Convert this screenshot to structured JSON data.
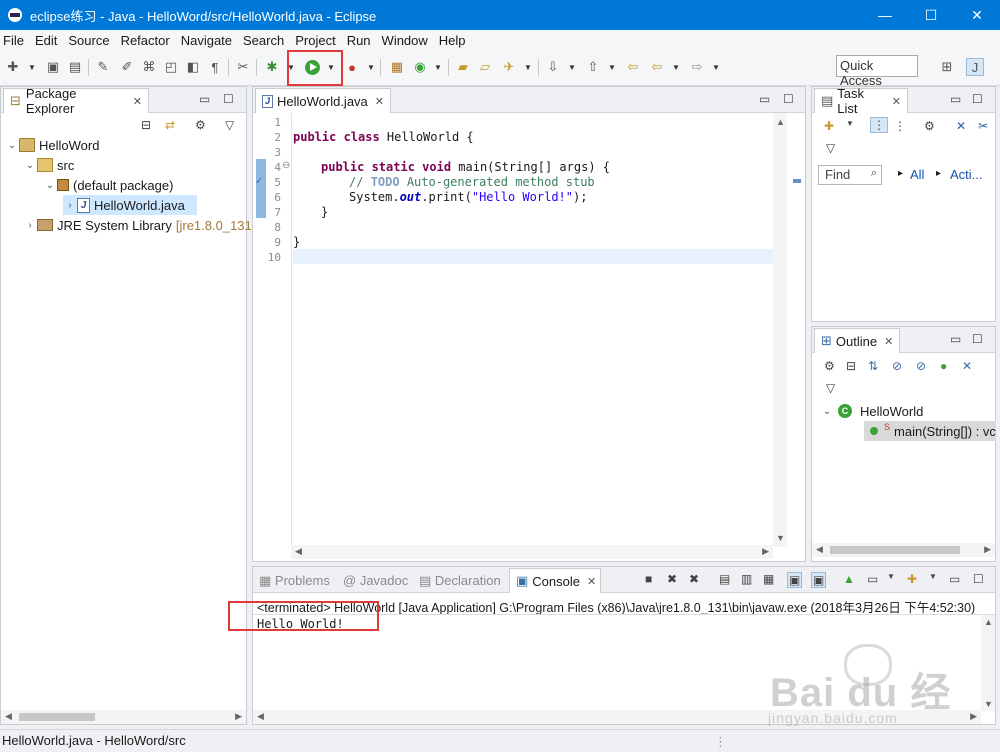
{
  "window": {
    "title": "eclipse练习 - Java - HelloWord/src/HelloWorld.java - Eclipse",
    "controls": [
      "—",
      "☐",
      "✕"
    ]
  },
  "menu": [
    "File",
    "Edit",
    "Source",
    "Refactor",
    "Navigate",
    "Search",
    "Project",
    "Run",
    "Window",
    "Help"
  ],
  "toolbar": {
    "quick_access": "Quick Access"
  },
  "package_explorer": {
    "tab_label": "Package Explorer",
    "tree": [
      {
        "label": "HelloWord",
        "extra": ""
      },
      {
        "label": "src",
        "extra": ""
      },
      {
        "label": "(default package)",
        "extra": ""
      },
      {
        "label": "HelloWorld.java",
        "extra": ""
      },
      {
        "label": "JRE System Library",
        "extra": "[jre1.8.0_131"
      }
    ]
  },
  "editor": {
    "tab_label": "HelloWorld.java",
    "line_numbers": [
      "1",
      "2",
      "3",
      "4",
      "5",
      "6",
      "7",
      "8",
      "9",
      "10"
    ],
    "code": {
      "l2_kw": "public class ",
      "l2_rest": "HelloWorld {",
      "l4_kw": "public static void ",
      "l4_rest": "main(String[] args) {",
      "l5_cm1": "// ",
      "l5_todo": "TODO",
      "l5_cm2": " Auto-generated method stub",
      "l6_a": "System.",
      "l6_fld": "out",
      "l6_b": ".print(",
      "l6_str": "\"Hello World!\"",
      "l6_c": ");",
      "l7": "}",
      "l9": "}"
    }
  },
  "task_list": {
    "tab_label": "Task List",
    "find_placeholder": "Find",
    "all_label": "All",
    "acti_label": "Acti..."
  },
  "outline": {
    "tab_label": "Outline",
    "class_name": "HelloWorld",
    "method_label": "main(String[]) : vc"
  },
  "bottom_tabs": [
    "Problems",
    "Javadoc",
    "Declaration",
    "Console"
  ],
  "console": {
    "header": "<terminated> HelloWorld [Java Application] G:\\Program Files (x86)\\Java\\jre1.8.0_131\\bin\\javaw.exe (2018年3月26日 下午4:52:30)",
    "output": "Hello World!"
  },
  "status_bar": {
    "text": "HelloWorld.java - HelloWord/src"
  },
  "watermark": {
    "main": "Bai du 经验",
    "sub": "jingyan.baidu.com"
  },
  "colors": {
    "title_bar": "#0078d7",
    "run_button": "#3aa335",
    "highlight_box": "#e03a3a",
    "keyword": "#7f0055",
    "string": "#2a00ff",
    "comment": "#3f7f5f"
  }
}
